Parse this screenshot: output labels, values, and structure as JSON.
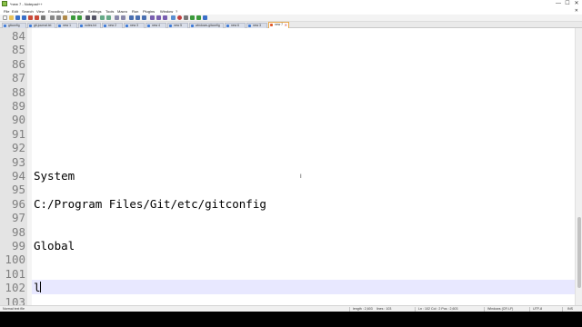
{
  "window": {
    "title": "*new 7 - Notepad++",
    "minimize_glyph": "—",
    "maximize_glyph": "☐",
    "close_glyph": "✕"
  },
  "menu": {
    "items": [
      "File",
      "Edit",
      "Search",
      "View",
      "Encoding",
      "Language",
      "Settings",
      "Tools",
      "Macro",
      "Run",
      "Plugins",
      "Window",
      "?"
    ],
    "close_glyph": "✕"
  },
  "tabs": [
    {
      "label": "gitconfig"
    },
    {
      "label": "git-journal.txt"
    },
    {
      "label": "new 1"
    },
    {
      "label": "notes.txt"
    },
    {
      "label": "new 2"
    },
    {
      "label": "new 3"
    },
    {
      "label": "new 4"
    },
    {
      "label": "new 5"
    },
    {
      "label": "windows-gitconfig"
    },
    {
      "label": "new 6"
    },
    {
      "label": "new 3"
    },
    {
      "label": "new 7"
    }
  ],
  "active_tab_close": "✕",
  "editor": {
    "lines": [
      {
        "number": "84",
        "text": ""
      },
      {
        "number": "85",
        "text": ""
      },
      {
        "number": "86",
        "text": ""
      },
      {
        "number": "87",
        "text": ""
      },
      {
        "number": "88",
        "text": ""
      },
      {
        "number": "89",
        "text": ""
      },
      {
        "number": "90",
        "text": ""
      },
      {
        "number": "91",
        "text": ""
      },
      {
        "number": "92",
        "text": ""
      },
      {
        "number": "93",
        "text": ""
      },
      {
        "number": "94",
        "text": "System"
      },
      {
        "number": "95",
        "text": ""
      },
      {
        "number": "96",
        "text": "C:/Program Files/Git/etc/gitconfig"
      },
      {
        "number": "97",
        "text": ""
      },
      {
        "number": "98",
        "text": ""
      },
      {
        "number": "99",
        "text": "Global"
      },
      {
        "number": "100",
        "text": ""
      },
      {
        "number": "101",
        "text": ""
      },
      {
        "number": "102",
        "text": "l"
      },
      {
        "number": "103",
        "text": ""
      }
    ],
    "mouse_cursor_glyph": "I"
  },
  "status": {
    "file_type": "Normal text file",
    "length": "length : 2,603",
    "lines": "lines : 103",
    "position": "Ln : 102    Col : 2    Pos : 2,603",
    "eol": "Windows (CR LF)",
    "encoding": "UTF-8",
    "mode": "INS"
  }
}
